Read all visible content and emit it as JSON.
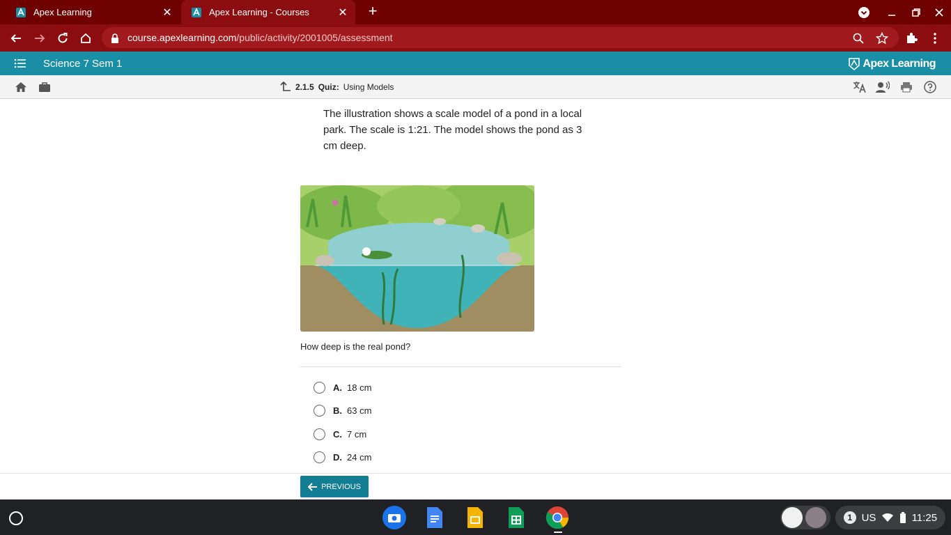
{
  "browser": {
    "tabs": [
      {
        "title": "Apex Learning",
        "active": false
      },
      {
        "title": "Apex Learning - Courses",
        "active": true
      }
    ],
    "url_host": "course.apexlearning.com",
    "url_path": "/public/activity/2001005/assessment"
  },
  "app": {
    "course_title": "Science 7 Sem 1",
    "brand": "Apex Learning"
  },
  "breadcrumb": {
    "number": "2.1.5",
    "type": "Quiz:",
    "title": "Using Models"
  },
  "quiz": {
    "prompt": "The illustration shows a scale model of a pond in a local park. The scale is 1:21. The model shows the pond as 3 cm deep.",
    "question": "How deep is the real pond?",
    "options": [
      {
        "letter": "A.",
        "text": "18 cm"
      },
      {
        "letter": "B.",
        "text": "63 cm"
      },
      {
        "letter": "C.",
        "text": "7 cm"
      },
      {
        "letter": "D.",
        "text": "24 cm"
      }
    ]
  },
  "footer": {
    "previous_label": "PREVIOUS"
  },
  "shelf": {
    "apps": [
      "camera-icon",
      "docs-icon",
      "slides-icon",
      "sheets-icon",
      "chrome-icon"
    ],
    "notification_count": "1",
    "keyboard_layout": "US",
    "time": "11:25"
  },
  "colors": {
    "tab_strip": "#6e0000",
    "toolbar": "#8b0d10",
    "app_bar": "#1a8ea5",
    "button": "#137d94"
  }
}
